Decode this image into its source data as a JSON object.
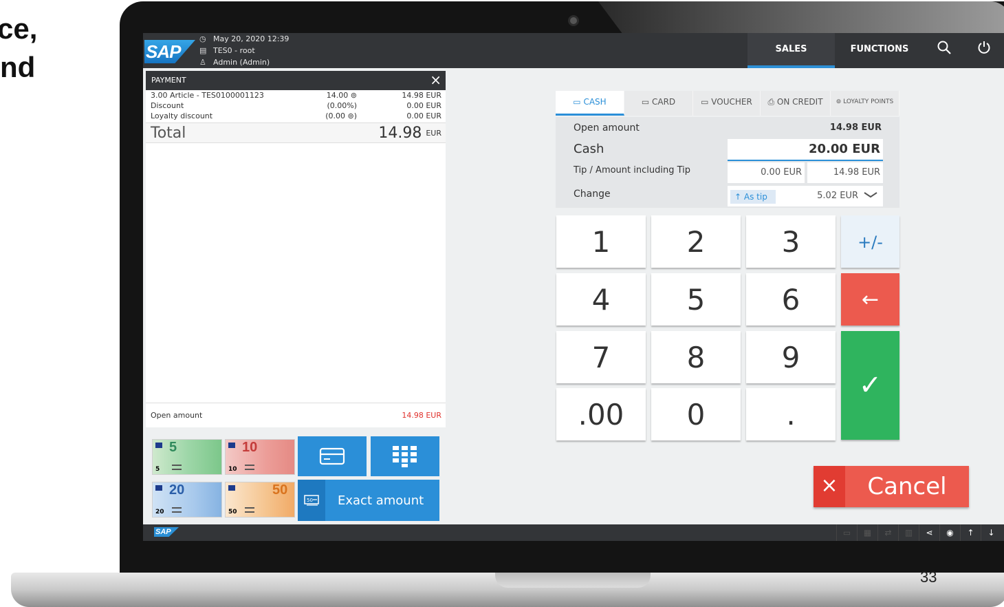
{
  "slide": {
    "line1": "ce,",
    "line2": "nd",
    "page_number": "33"
  },
  "header": {
    "logo": "SAP",
    "datetime": "May 20, 2020 12:39",
    "terminal": "TES0 - root",
    "user": "Admin (Admin)",
    "nav": {
      "sales": "SALES",
      "functions": "FUNCTIONS"
    },
    "icons": {
      "search": "search-icon",
      "power": "power-icon"
    }
  },
  "receipt": {
    "title": "PAYMENT",
    "close_icon": "×",
    "lines": [
      {
        "label": "3.00 Article - TES0100001123",
        "mid": "14.00 ⊚",
        "amount": "14.98 EUR"
      },
      {
        "label": "Discount",
        "mid": "(0.00%)",
        "amount": "0.00 EUR"
      },
      {
        "label": "Loyalty discount",
        "mid": "(0.00 ⊚)",
        "amount": "0.00 EUR"
      }
    ],
    "total_label": "Total",
    "total_value": "14.98",
    "total_currency": "EUR",
    "open_amount_label": "Open amount",
    "open_amount_value": "14.98 EUR"
  },
  "quick_cash": {
    "bills": [
      {
        "value": "5",
        "small": "5"
      },
      {
        "value": "10",
        "small": "10"
      },
      {
        "value": "20",
        "small": "20"
      },
      {
        "value": "50",
        "small": "50"
      }
    ],
    "card_icon": "card-icon",
    "keypad_icon": "keypad-icon",
    "exact_amount": "Exact amount",
    "exact_icon": "50"
  },
  "payment": {
    "tabs": [
      "CASH",
      "CARD",
      "VOUCHER",
      "ON CREDIT",
      "LOYALTY POINTS"
    ],
    "tab_icons": [
      "▭",
      "▭",
      "▭",
      "⎙",
      "⊚"
    ],
    "open_amount_label": "Open amount",
    "open_amount_value": "14.98 EUR",
    "cash_label": "Cash",
    "cash_value": "20.00 EUR",
    "tip_label": "Tip / Amount including Tip",
    "tip_value": "0.00 EUR",
    "tip_total": "14.98 EUR",
    "change_label": "Change",
    "as_tip": "As tip",
    "change_value": "5.02 EUR"
  },
  "keypad": {
    "keys": [
      "1",
      "2",
      "3",
      "4",
      "5",
      "6",
      "7",
      "8",
      "9",
      ".00",
      "0",
      "."
    ],
    "plus_minus": "+/-",
    "backspace": "←",
    "confirm": "✓"
  },
  "cancel": {
    "icon": "×",
    "label": "Cancel"
  },
  "colors": {
    "accent": "#2b8fd8",
    "cancel": "#ec5a4e",
    "confirm": "#2fb45e",
    "bar": "#333538"
  }
}
